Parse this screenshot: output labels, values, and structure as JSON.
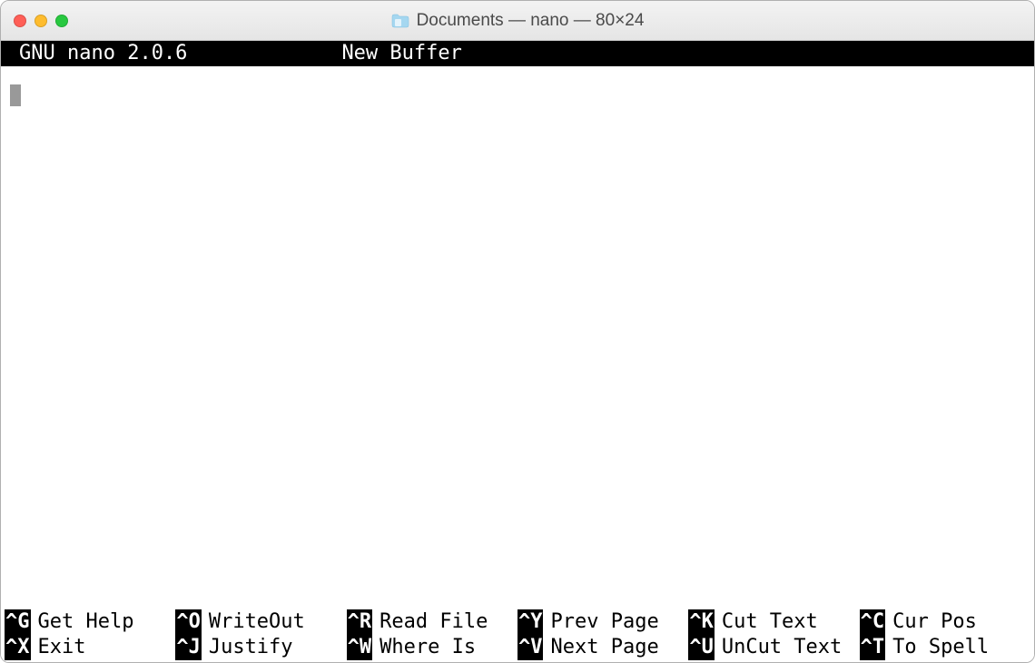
{
  "window": {
    "title": "Documents — nano — 80×24"
  },
  "nano": {
    "version": "GNU nano 2.0.6",
    "buffer_label": "New Buffer"
  },
  "shortcuts": {
    "row1": [
      {
        "key": "^G",
        "label": "Get Help"
      },
      {
        "key": "^O",
        "label": "WriteOut"
      },
      {
        "key": "^R",
        "label": "Read File"
      },
      {
        "key": "^Y",
        "label": "Prev Page"
      },
      {
        "key": "^K",
        "label": "Cut Text"
      },
      {
        "key": "^C",
        "label": "Cur Pos"
      }
    ],
    "row2": [
      {
        "key": "^X",
        "label": "Exit"
      },
      {
        "key": "^J",
        "label": "Justify"
      },
      {
        "key": "^W",
        "label": "Where Is"
      },
      {
        "key": "^V",
        "label": "Next Page"
      },
      {
        "key": "^U",
        "label": "UnCut Text"
      },
      {
        "key": "^T",
        "label": "To Spell"
      }
    ]
  }
}
